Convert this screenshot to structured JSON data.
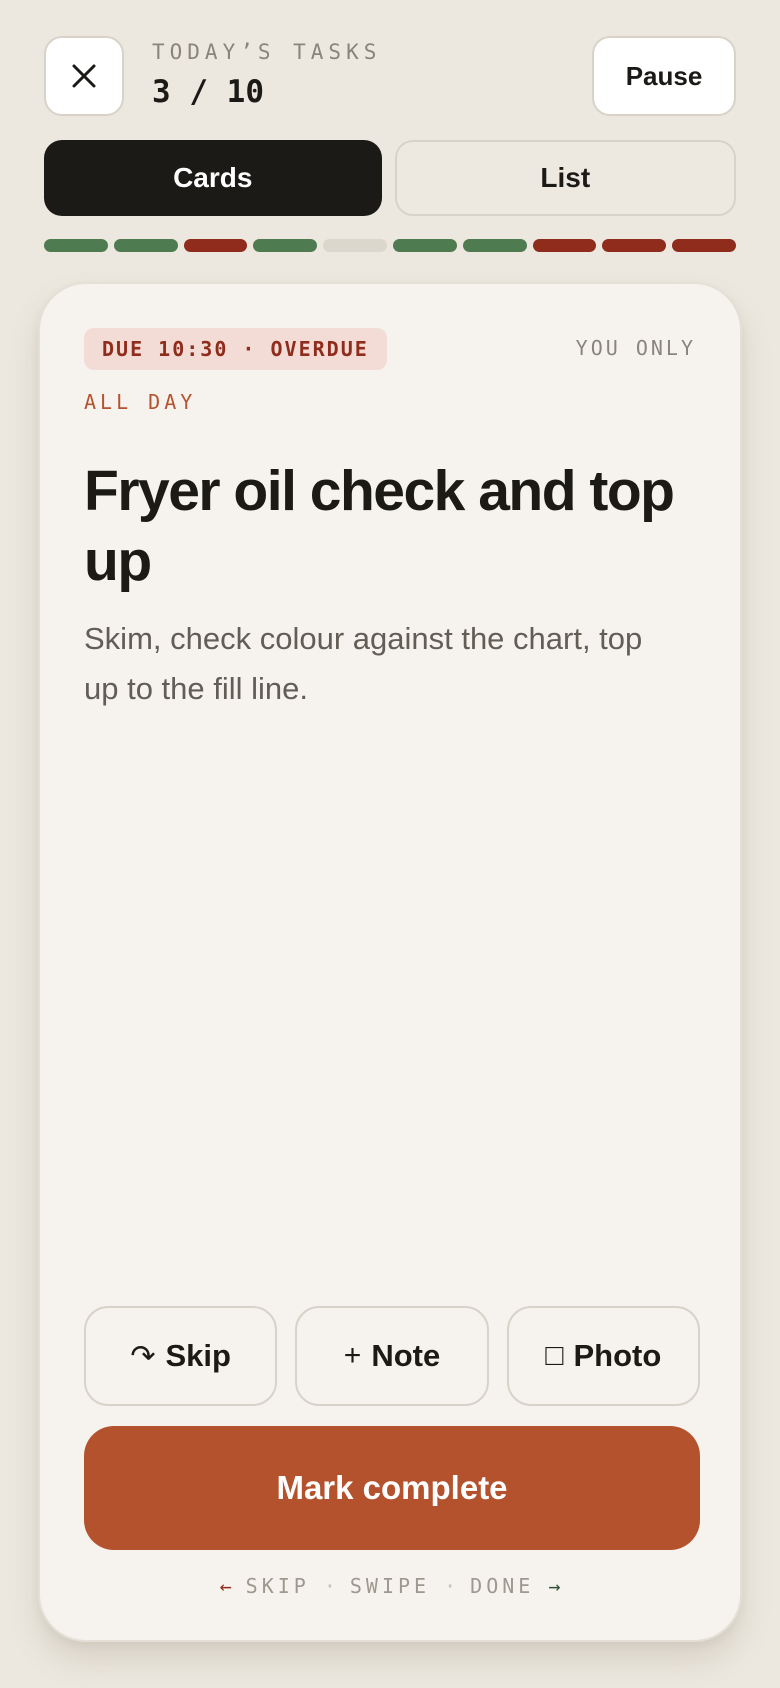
{
  "header": {
    "close_icon": "close-icon",
    "kicker": "TODAY’S TASKS",
    "count": "3 / 10",
    "pause_label": "Pause"
  },
  "tabs": [
    {
      "label": "Cards",
      "active": true
    },
    {
      "label": "List",
      "active": false
    }
  ],
  "progress": {
    "statuses": [
      "done",
      "done",
      "overdue",
      "done",
      "pending",
      "done",
      "done",
      "overdue",
      "overdue",
      "overdue"
    ],
    "colors": {
      "done": "#4f7b50",
      "overdue": "#8f2c1c",
      "pending": "#dcd7cd"
    }
  },
  "card": {
    "due_badge": "DUE 10:30 · OVERDUE",
    "assignee": "YOU ONLY",
    "schedule": "ALL DAY",
    "title": "Fryer oil check and top up",
    "description": "Skim, check colour against the chart, top up to the fill line.",
    "actions": [
      {
        "icon": "↷",
        "label": "Skip"
      },
      {
        "icon": "+",
        "label": "Note"
      },
      {
        "icon": "□",
        "label": "Photo"
      }
    ],
    "complete_label": "Mark complete",
    "hint": {
      "left_arrow": "←",
      "skip": "SKIP",
      "sep": "·",
      "swipe": "SWIPE",
      "done": "DONE",
      "right_arrow": "→"
    }
  },
  "colors": {
    "accent": "#b3522d",
    "background": "#ece8df",
    "overdue_text": "#8f2c1c",
    "done_green": "#4f7b50"
  }
}
